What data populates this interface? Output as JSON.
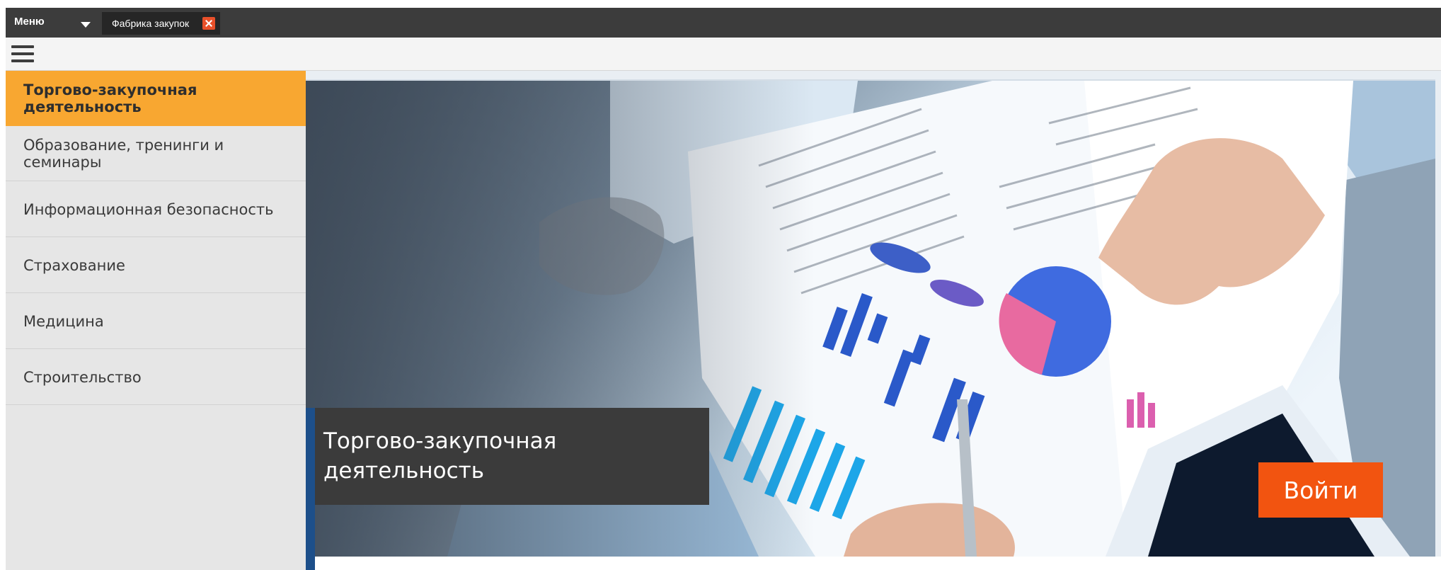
{
  "topbar": {
    "menu_label": "Меню",
    "tab_label": "Фабрика закупок"
  },
  "sidebar": {
    "items": [
      {
        "label": "Торгово-закупочная деятельность",
        "active": true
      },
      {
        "label": "Образование, тренинги и семинары",
        "active": false
      },
      {
        "label": "Информационная безопасность",
        "active": false
      },
      {
        "label": "Страхование",
        "active": false
      },
      {
        "label": "Медицина",
        "active": false
      },
      {
        "label": "Строительство",
        "active": false
      }
    ]
  },
  "banner": {
    "caption": "Торгово-закупочная деятельность",
    "login_label": "Войти"
  },
  "colors": {
    "topbar": "#3c3c3c",
    "active_item": "#f8a731",
    "login_button": "#f25410",
    "close_icon": "#e8502a",
    "accent": "#1d4f8a"
  }
}
